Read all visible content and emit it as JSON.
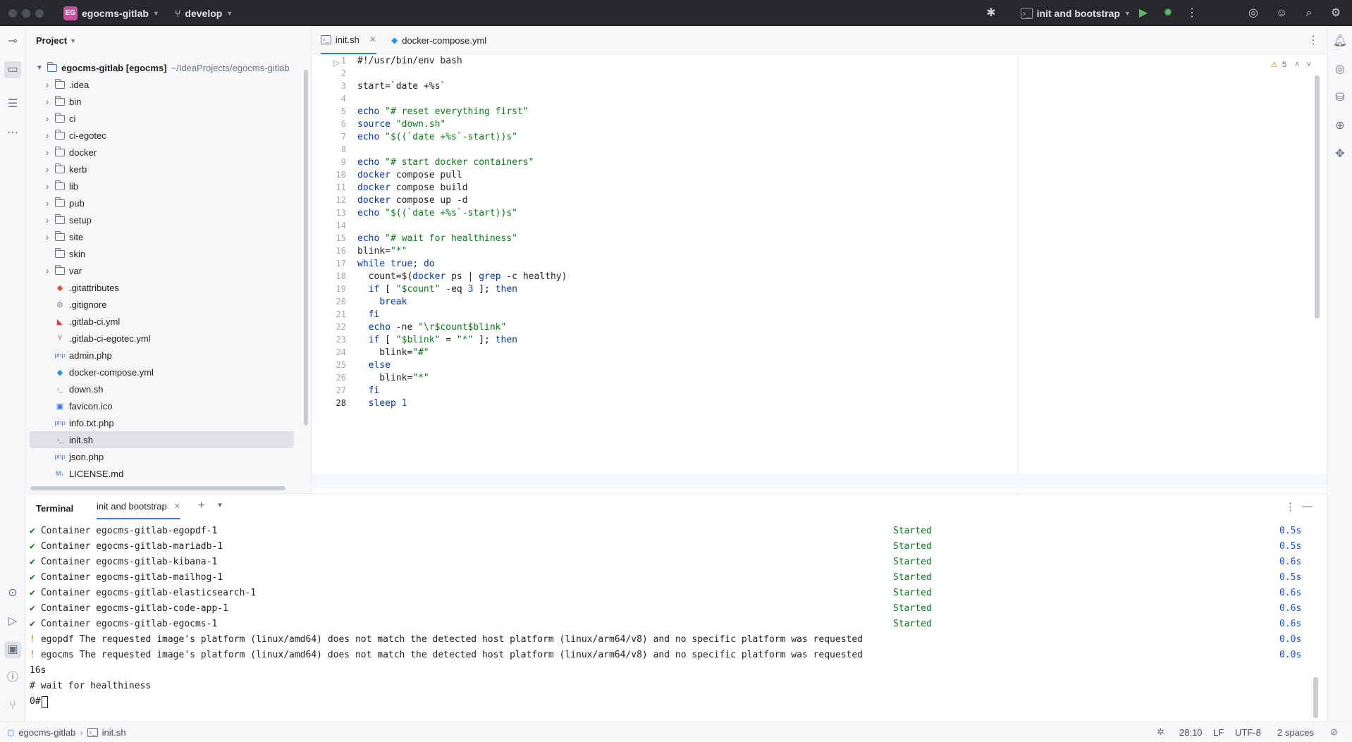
{
  "titlebar": {
    "project_badge": "EG",
    "project_name": "egocms-gitlab",
    "branch": "develop",
    "run_config": "init and bootstrap"
  },
  "project_panel": {
    "title": "Project",
    "root_name": "egocms-gitlab [egocms]",
    "root_path": "~/IdeaProjects/egocms-gitlab",
    "items": [
      {
        "label": ".idea",
        "type": "folder",
        "expandable": true
      },
      {
        "label": "bin",
        "type": "folder",
        "expandable": true
      },
      {
        "label": "ci",
        "type": "folder",
        "expandable": true
      },
      {
        "label": "ci-egotec",
        "type": "folder",
        "expandable": true
      },
      {
        "label": "docker",
        "type": "folder",
        "expandable": true
      },
      {
        "label": "kerb",
        "type": "folder",
        "expandable": true
      },
      {
        "label": "lib",
        "type": "folder",
        "expandable": true
      },
      {
        "label": "pub",
        "type": "folder",
        "expandable": true
      },
      {
        "label": "setup",
        "type": "folder",
        "expandable": true
      },
      {
        "label": "site",
        "type": "folder",
        "expandable": true
      },
      {
        "label": "skin",
        "type": "folder",
        "expandable": false
      },
      {
        "label": "var",
        "type": "folder",
        "expandable": true
      },
      {
        "label": ".gitattributes",
        "type": "git"
      },
      {
        "label": ".gitignore",
        "type": "ignore"
      },
      {
        "label": ".gitlab-ci.yml",
        "type": "gitlab"
      },
      {
        "label": ".gitlab-ci-egotec.yml",
        "type": "yaml"
      },
      {
        "label": "admin.php",
        "type": "php"
      },
      {
        "label": "docker-compose.yml",
        "type": "docker"
      },
      {
        "label": "down.sh",
        "type": "shell"
      },
      {
        "label": "favicon.ico",
        "type": "image"
      },
      {
        "label": "info.txt.php",
        "type": "php"
      },
      {
        "label": "init.sh",
        "type": "shell",
        "selected": true
      },
      {
        "label": "json.php",
        "type": "php"
      },
      {
        "label": "LICENSE.md",
        "type": "md"
      }
    ]
  },
  "editor": {
    "tabs": [
      {
        "label": "init.sh",
        "active": true
      },
      {
        "label": "docker-compose.yml",
        "active": false
      }
    ],
    "warnings": "5",
    "lines": [
      {
        "n": "1",
        "t": "#!/usr/bin/env bash"
      },
      {
        "n": "2",
        "t": ""
      },
      {
        "n": "3",
        "t": "start=`date +%s`"
      },
      {
        "n": "4",
        "t": ""
      },
      {
        "n": "5",
        "t": "echo \"# reset everything first\""
      },
      {
        "n": "6",
        "t": "source \"down.sh\""
      },
      {
        "n": "7",
        "t": "echo \"$((`date +%s`-start))s\""
      },
      {
        "n": "8",
        "t": ""
      },
      {
        "n": "9",
        "t": "echo \"# start docker containers\""
      },
      {
        "n": "10",
        "t": "docker compose pull"
      },
      {
        "n": "11",
        "t": "docker compose build"
      },
      {
        "n": "12",
        "t": "docker compose up -d"
      },
      {
        "n": "13",
        "t": "echo \"$((`date +%s`-start))s\""
      },
      {
        "n": "14",
        "t": ""
      },
      {
        "n": "15",
        "t": "echo \"# wait for healthiness\""
      },
      {
        "n": "16",
        "t": "blink=\"*\""
      },
      {
        "n": "17",
        "t": "while true; do"
      },
      {
        "n": "18",
        "t": "  count=$(docker ps | grep -c healthy)"
      },
      {
        "n": "19",
        "t": "  if [ \"$count\" -eq 3 ]; then"
      },
      {
        "n": "20",
        "t": "    break"
      },
      {
        "n": "21",
        "t": "  fi"
      },
      {
        "n": "22",
        "t": "  echo -ne \"\\r$count$blink\""
      },
      {
        "n": "23",
        "t": "  if [ \"$blink\" = \"*\" ]; then"
      },
      {
        "n": "24",
        "t": "    blink=\"#\""
      },
      {
        "n": "25",
        "t": "  else"
      },
      {
        "n": "26",
        "t": "    blink=\"*\""
      },
      {
        "n": "27",
        "t": "  fi"
      },
      {
        "n": "28",
        "t": "  sleep 1"
      }
    ]
  },
  "terminal": {
    "title": "Terminal",
    "tab": "init and bootstrap",
    "lines": [
      {
        "mark": "✔",
        "text": "Container egocms-gitlab-egopdf-1",
        "status": "Started",
        "time": "0.5s"
      },
      {
        "mark": "✔",
        "text": "Container egocms-gitlab-mariadb-1",
        "status": "Started",
        "time": "0.5s"
      },
      {
        "mark": "✔",
        "text": "Container egocms-gitlab-kibana-1",
        "status": "Started",
        "time": "0.6s"
      },
      {
        "mark": "✔",
        "text": "Container egocms-gitlab-mailhog-1",
        "status": "Started",
        "time": "0.5s"
      },
      {
        "mark": "✔",
        "text": "Container egocms-gitlab-elasticsearch-1",
        "status": "Started",
        "time": "0.6s"
      },
      {
        "mark": "✔",
        "text": "Container egocms-gitlab-code-app-1",
        "status": "Started",
        "time": "0.6s"
      },
      {
        "mark": "✔",
        "text": "Container egocms-gitlab-egocms-1",
        "status": "Started",
        "time": "0.6s"
      },
      {
        "mark": "!",
        "text": "egopdf The requested image's platform (linux/amd64) does not match the detected host platform (linux/arm64/v8) and no specific platform was requested",
        "status": "",
        "time": "0.0s"
      },
      {
        "mark": "!",
        "text": "egocms The requested image's platform (linux/amd64) does not match the detected host platform (linux/arm64/v8) and no specific platform was requested",
        "status": "",
        "time": "0.0s"
      }
    ],
    "plain": [
      "16s",
      "# wait for healthiness",
      "0#"
    ]
  },
  "statusbar": {
    "crumb1": "egocms-gitlab",
    "crumb2": "init.sh",
    "position": "28:10",
    "line_sep": "LF",
    "encoding": "UTF-8",
    "indent": "2 spaces"
  }
}
